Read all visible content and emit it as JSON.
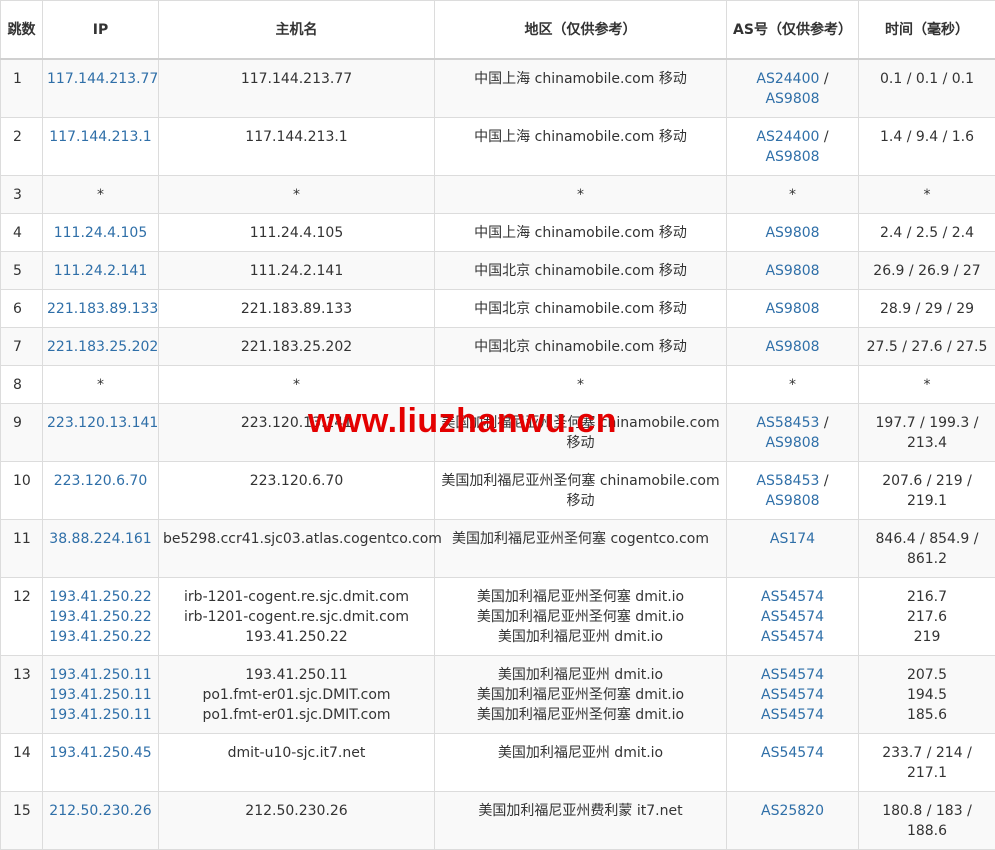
{
  "headers": {
    "hop": "跳数",
    "ip": "IP",
    "hostname": "主机名",
    "region": "地区（仅供参考）",
    "as": "AS号（仅供参考）",
    "time": "时间（毫秒）"
  },
  "rows": [
    {
      "hop": "1",
      "ip": [
        "117.144.213.77"
      ],
      "host": [
        "117.144.213.77"
      ],
      "region": [
        "中国上海 chinamobile.com 移动"
      ],
      "as": [
        [
          "AS24400",
          "AS9808"
        ]
      ],
      "time": "0.1 / 0.1 / 0.1"
    },
    {
      "hop": "2",
      "ip": [
        "117.144.213.1"
      ],
      "host": [
        "117.144.213.1"
      ],
      "region": [
        "中国上海 chinamobile.com 移动"
      ],
      "as": [
        [
          "AS24400",
          "AS9808"
        ]
      ],
      "time": "1.4 / 9.4 / 1.6"
    },
    {
      "hop": "3",
      "ip": [
        "*"
      ],
      "host": [
        "*"
      ],
      "region": [
        "*"
      ],
      "as": [
        [
          "*"
        ]
      ],
      "time": "*",
      "ip_plain": true
    },
    {
      "hop": "4",
      "ip": [
        "111.24.4.105"
      ],
      "host": [
        "111.24.4.105"
      ],
      "region": [
        "中国上海 chinamobile.com 移动"
      ],
      "as": [
        [
          "AS9808"
        ]
      ],
      "time": "2.4 / 2.5 / 2.4"
    },
    {
      "hop": "5",
      "ip": [
        "111.24.2.141"
      ],
      "host": [
        "111.24.2.141"
      ],
      "region": [
        "中国北京 chinamobile.com 移动"
      ],
      "as": [
        [
          "AS9808"
        ]
      ],
      "time": "26.9 / 26.9 / 27"
    },
    {
      "hop": "6",
      "ip": [
        "221.183.89.133"
      ],
      "host": [
        "221.183.89.133"
      ],
      "region": [
        "中国北京 chinamobile.com 移动"
      ],
      "as": [
        [
          "AS9808"
        ]
      ],
      "time": "28.9 / 29 / 29"
    },
    {
      "hop": "7",
      "ip": [
        "221.183.25.202"
      ],
      "host": [
        "221.183.25.202"
      ],
      "region": [
        "中国北京 chinamobile.com 移动"
      ],
      "as": [
        [
          "AS9808"
        ]
      ],
      "time": "27.5 / 27.6 / 27.5"
    },
    {
      "hop": "8",
      "ip": [
        "*"
      ],
      "host": [
        "*"
      ],
      "region": [
        "*"
      ],
      "as": [
        [
          "*"
        ]
      ],
      "time": "*",
      "ip_plain": true
    },
    {
      "hop": "9",
      "ip": [
        "223.120.13.141"
      ],
      "host": [
        "223.120.13.141"
      ],
      "region": [
        "美国加利福尼亚州圣何塞 chinamobile.com 移动"
      ],
      "as": [
        [
          "AS58453",
          "AS9808"
        ]
      ],
      "time": "197.7 / 199.3 / 213.4"
    },
    {
      "hop": "10",
      "ip": [
        "223.120.6.70"
      ],
      "host": [
        "223.120.6.70"
      ],
      "region": [
        "美国加利福尼亚州圣何塞 chinamobile.com 移动"
      ],
      "as": [
        [
          "AS58453",
          "AS9808"
        ]
      ],
      "time": "207.6 / 219 / 219.1"
    },
    {
      "hop": "11",
      "ip": [
        "38.88.224.161"
      ],
      "host": [
        "be5298.ccr41.sjc03.atlas.cogentco.com"
      ],
      "region": [
        "美国加利福尼亚州圣何塞 cogentco.com"
      ],
      "as": [
        [
          "AS174"
        ]
      ],
      "time": "846.4 / 854.9 / 861.2"
    },
    {
      "hop": "12",
      "ip": [
        "193.41.250.22",
        "193.41.250.22",
        "193.41.250.22"
      ],
      "host": [
        "irb-1201-cogent.re.sjc.dmit.com",
        "irb-1201-cogent.re.sjc.dmit.com",
        "193.41.250.22"
      ],
      "region": [
        "美国加利福尼亚州圣何塞 dmit.io",
        "美国加利福尼亚州圣何塞 dmit.io",
        "美国加利福尼亚州 dmit.io"
      ],
      "as": [
        [
          "AS54574"
        ],
        [
          "AS54574"
        ],
        [
          "AS54574"
        ]
      ],
      "time_lines": [
        "216.7",
        "217.6",
        "219"
      ]
    },
    {
      "hop": "13",
      "ip": [
        "193.41.250.11",
        "193.41.250.11",
        "193.41.250.11"
      ],
      "host": [
        "193.41.250.11",
        "po1.fmt-er01.sjc.DMIT.com",
        "po1.fmt-er01.sjc.DMIT.com"
      ],
      "region": [
        "美国加利福尼亚州 dmit.io",
        "美国加利福尼亚州圣何塞 dmit.io",
        "美国加利福尼亚州圣何塞 dmit.io"
      ],
      "as": [
        [
          "AS54574"
        ],
        [
          "AS54574"
        ],
        [
          "AS54574"
        ]
      ],
      "time_lines": [
        "207.5",
        "194.5",
        "185.6"
      ]
    },
    {
      "hop": "14",
      "ip": [
        "193.41.250.45"
      ],
      "host": [
        "dmit-u10-sjc.it7.net"
      ],
      "region": [
        "美国加利福尼亚州 dmit.io"
      ],
      "as": [
        [
          "AS54574"
        ]
      ],
      "time": "233.7 / 214 / 217.1"
    },
    {
      "hop": "15",
      "ip": [
        "212.50.230.26"
      ],
      "host": [
        "212.50.230.26"
      ],
      "region": [
        "美国加利福尼亚州费利蒙 it7.net"
      ],
      "as": [
        [
          "AS25820"
        ]
      ],
      "time": "180.8 / 183 / 188.6"
    }
  ],
  "watermark": "www.liuzhanwu.cn",
  "colors": {
    "link": "#2f6fa8",
    "watermark": "#e40000",
    "row_alt": "#f9f9f9",
    "border": "#dcdcdc"
  }
}
